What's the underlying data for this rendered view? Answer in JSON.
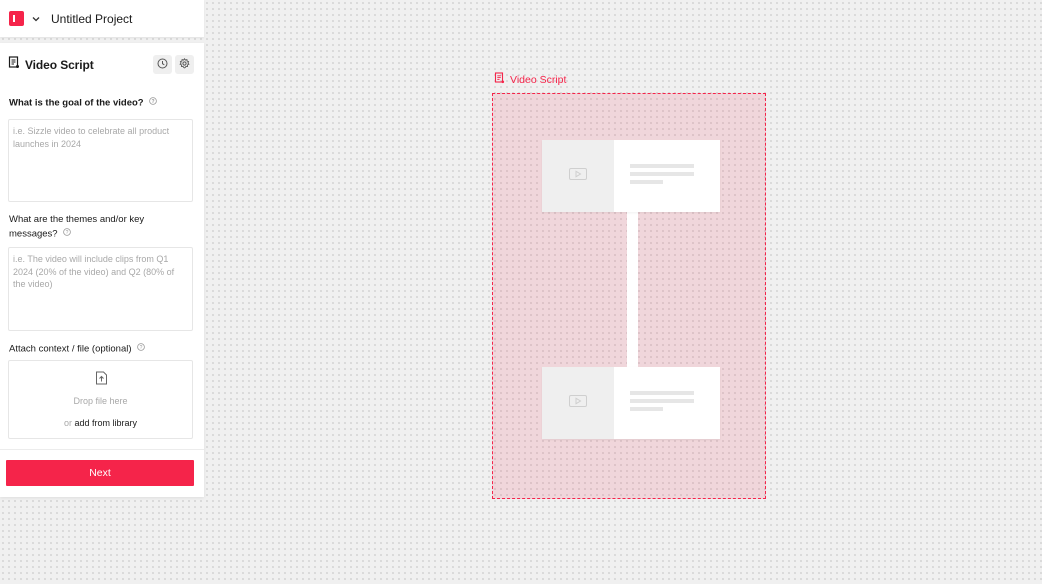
{
  "app": {
    "project_title": "Untitled Project",
    "logo_icon": "app-logo-icon",
    "brand_color": "#f5244a"
  },
  "panel": {
    "title": "Video Script",
    "title_icon": "script-icon",
    "history_icon": "clock-icon",
    "settings_icon": "gear-icon",
    "q1": {
      "label": "What is the goal of the video?",
      "placeholder": "i.e. Sizzle video to celebrate all product launches in 2024"
    },
    "q2": {
      "label_line1": "What are the themes and/or key",
      "label_line2": "messages?",
      "placeholder": "i.e. The video will include clips from Q1 2024 (20% of the video) and Q2 (80% of the video)"
    },
    "attach": {
      "label": "Attach context / file (optional)",
      "drop_text": "Drop file here",
      "or_text": "or",
      "library_link": "add from library"
    },
    "next_label": "Next"
  },
  "canvas": {
    "frame_label": "Video Script"
  }
}
